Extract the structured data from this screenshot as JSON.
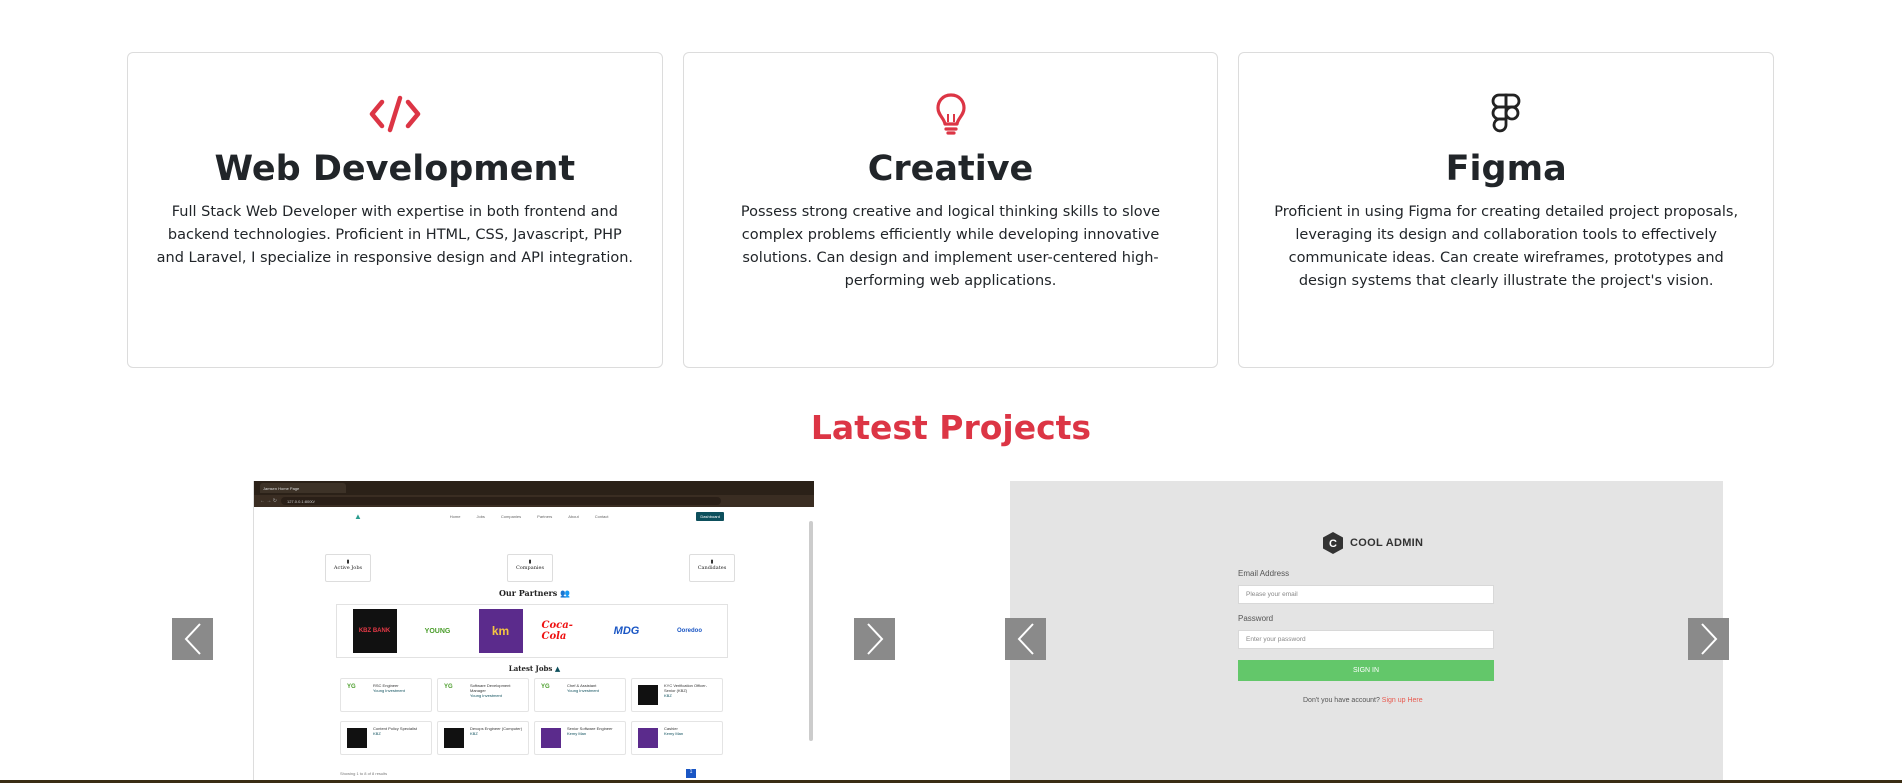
{
  "skills": [
    {
      "icon": "code-icon",
      "title": "Web Development",
      "text": "Full Stack Web Developer with expertise in both frontend and backend technologies. Proficient in HTML, CSS, Javascript, PHP and Laravel, I specialize in responsive design and API integration."
    },
    {
      "icon": "lightbulb-icon",
      "title": "Creative",
      "text": "Possess strong creative and logical thinking skills to slove complex problems efficiently while developing innovative solutions. Can design and implement user-centered high-performing web applications."
    },
    {
      "icon": "figma-icon",
      "title": "Figma",
      "text": "Proficient in using Figma for creating detailed project proposals, leveraging its design and collaboration tools to effectively communicate ideas. Can create wireframes, prototypes and design systems that clearly illustrate the project's vision."
    }
  ],
  "projects": {
    "title": "Latest Projects",
    "p1": {
      "tab_label": "Jamsen Home Page",
      "url": "127.0.0.1:8000/",
      "nav": [
        "Home",
        "Jobs",
        "Companies",
        "Partners",
        "About",
        "Contact"
      ],
      "cta": "Dashboard",
      "stats": [
        "Active Jobs",
        "Companies",
        "Candidates"
      ],
      "partners_title": "Our Partners",
      "partners": [
        "KBZ BANK",
        "YOUNG",
        "km",
        "Coca-Cola",
        "MDG",
        "Ooredoo"
      ],
      "jobs_title": "Latest Jobs",
      "jobs": [
        {
          "title": "RSC Engineer",
          "company": "Young Investment"
        },
        {
          "title": "Software Development Manager",
          "company": "Young Investment"
        },
        {
          "title": "Chef & Assistant",
          "company": "Young Investment"
        },
        {
          "title": "KYC Verification Officer- Senior (KBZ)",
          "company": "KBZ"
        },
        {
          "title": "Content Policy Specialist",
          "company": "KBZ"
        },
        {
          "title": "Devops Engineer (Computer)",
          "company": "KBZ"
        },
        {
          "title": "Senior Software Engineer",
          "company": "Kemy Man"
        },
        {
          "title": "Cashier",
          "company": "Kemy Man"
        }
      ],
      "showing": "Showing 1 to 8 of 8 results",
      "page": "1"
    },
    "p2": {
      "brand": "COOL ADMIN",
      "email_label": "Email Address",
      "email_placeholder": "Please your email",
      "password_label": "Password",
      "password_placeholder": "Enter your password",
      "signin": "SIGN IN",
      "foot": "Don't you have account?",
      "foot_link": "Sign up Here"
    }
  },
  "colors": {
    "accent": "#dc3545",
    "arrow_bg": "#8a8a8a",
    "signin_bg": "#63c76a"
  }
}
